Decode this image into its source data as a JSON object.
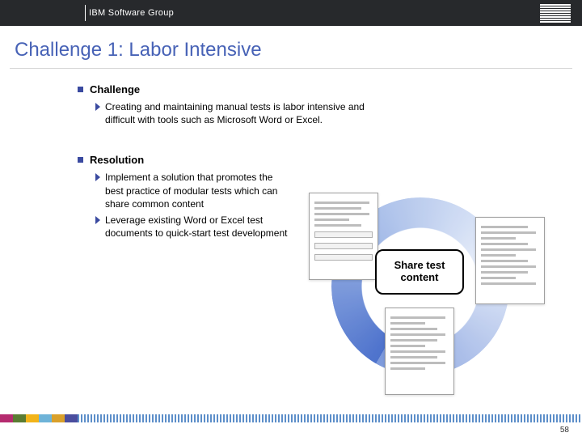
{
  "header": {
    "group": "IBM Software Group"
  },
  "title": "Challenge 1: Labor Intensive",
  "sections": {
    "challenge": {
      "heading": "Challenge",
      "items": [
        "Creating and maintaining manual tests is labor intensive and difficult with tools such as Microsoft Word or Excel."
      ]
    },
    "resolution": {
      "heading": "Resolution",
      "items": [
        "Implement a solution that promotes the best practice of modular tests which can share common content",
        "Leverage existing Word or Excel test documents to quick-start test development"
      ]
    }
  },
  "callout": "Share test content",
  "page_number": "58"
}
